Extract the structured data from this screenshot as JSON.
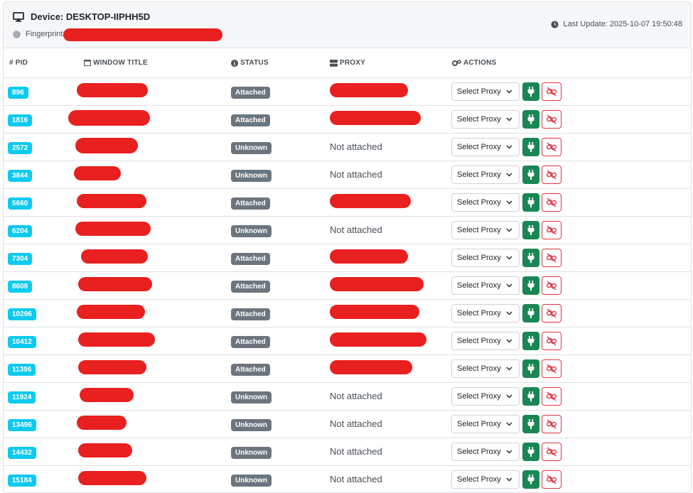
{
  "header": {
    "device_title": "Device: DESKTOP-IIPHH5D",
    "fingerprint_label": "Fingerprint",
    "last_update": "Last Update: 2025-10-07 19:50:48"
  },
  "table": {
    "columns": [
      "# PID",
      "WINDOW TITLE",
      "STATUS",
      "PROXY",
      "ACTIONS"
    ],
    "select_label": "Select Proxy",
    "rows": [
      {
        "pid": "896",
        "status": "Attached",
        "proxy": ""
      },
      {
        "pid": "1816",
        "status": "Attached",
        "proxy": ""
      },
      {
        "pid": "2572",
        "status": "Unknown",
        "proxy": "Not attached"
      },
      {
        "pid": "3844",
        "status": "Unknown",
        "proxy": "Not attached"
      },
      {
        "pid": "5660",
        "status": "Attached",
        "proxy": ""
      },
      {
        "pid": "6204",
        "status": "Unknown",
        "proxy": "Not attached"
      },
      {
        "pid": "7304",
        "status": "Attached",
        "proxy": ""
      },
      {
        "pid": "8608",
        "status": "Attached",
        "proxy": ""
      },
      {
        "pid": "10296",
        "status": "Attached",
        "proxy": ""
      },
      {
        "pid": "10412",
        "status": "Attached",
        "proxy": ""
      },
      {
        "pid": "11396",
        "status": "Attached",
        "proxy": ""
      },
      {
        "pid": "11924",
        "status": "Unknown",
        "proxy": "Not attached"
      },
      {
        "pid": "13496",
        "status": "Unknown",
        "proxy": "Not attached"
      },
      {
        "pid": "14432",
        "status": "Unknown",
        "proxy": "Not attached"
      },
      {
        "pid": "15184",
        "status": "Unknown",
        "proxy": "Not attached"
      }
    ]
  },
  "colors": {
    "pid_badge": "#0dcaf0",
    "status_badge": "#6c757d",
    "attach_button": "#198754",
    "detach_border": "#dc3545",
    "redaction": "#e8201f"
  },
  "icons": {
    "device": "monitor-icon",
    "fingerprint": "fingerprint-icon",
    "last_update": "clock-icon",
    "window_title": "window-icon",
    "status": "info-circle-icon",
    "proxy": "server-icon",
    "actions": "gears-icon",
    "attach": "plug-icon",
    "detach": "unlink-icon",
    "dropdown": "chevron-down-icon"
  }
}
